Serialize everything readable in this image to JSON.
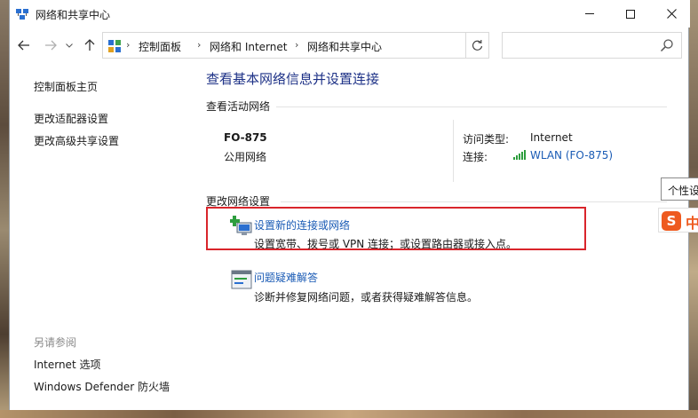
{
  "window": {
    "title": "网络和共享中心"
  },
  "address_bar": {
    "crumbs": [
      "控制面板",
      "网络和 Internet",
      "网络和共享中心"
    ],
    "search_placeholder": ""
  },
  "left_panel": {
    "links": [
      "控制面板主页",
      "更改适配器设置",
      "更改高级共享设置"
    ],
    "see_also_heading": "另请参阅",
    "see_also_links": [
      "Internet 选项",
      "Windows Defender 防火墙"
    ]
  },
  "main": {
    "title": "查看基本网络信息并设置连接",
    "active_networks_label": "查看活动网络",
    "network": {
      "name": "FO-875",
      "type": "公用网络",
      "access_type_label": "访问类型:",
      "access_type_value": "Internet",
      "connections_label": "连接:",
      "connection_value": "WLAN (FO-875)"
    },
    "change_settings_label": "更改网络设置",
    "tasks": [
      {
        "link": "设置新的连接或网络",
        "description": "设置宽带、拨号或 VPN 连接；或设置路由器或接入点。"
      },
      {
        "link": "问题疑难解答",
        "description": "诊断并修复网络问题，或者获得疑难解答信息。"
      }
    ]
  },
  "overlay": {
    "tooltip_text": "个性设",
    "ime_text": "中"
  },
  "colors": {
    "link_blue": "#1a5bb5",
    "title_blue": "#1e3287",
    "highlight_red": "#d9252b",
    "ime_orange": "#ee5a1f"
  }
}
